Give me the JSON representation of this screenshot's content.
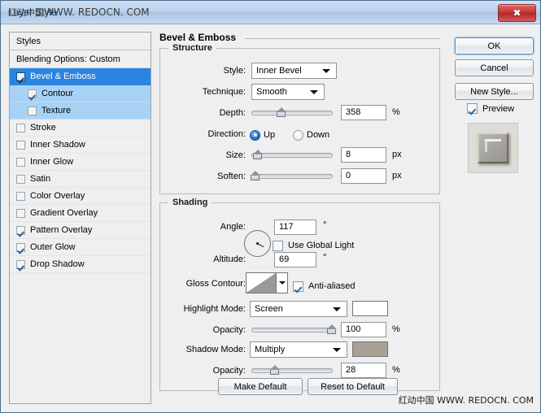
{
  "window": {
    "title": "Layer Style",
    "title_watermark_cn": "红动中国",
    "title_watermark_url": "WWW. REDOCN. COM",
    "close_icon": "close-icon",
    "footer_watermark": "红动中国  WWW. REDOCN. COM"
  },
  "styles_panel": {
    "header": "Styles",
    "blending_options": "Blending Options: Custom",
    "items": [
      {
        "label": "Bevel & Emboss",
        "checked": true,
        "selected": true,
        "sub": false
      },
      {
        "label": "Contour",
        "checked": true,
        "selected": false,
        "sub": true
      },
      {
        "label": "Texture",
        "checked": false,
        "selected": false,
        "sub": true
      },
      {
        "label": "Stroke",
        "checked": false,
        "selected": false,
        "sub": false
      },
      {
        "label": "Inner Shadow",
        "checked": false,
        "selected": false,
        "sub": false
      },
      {
        "label": "Inner Glow",
        "checked": false,
        "selected": false,
        "sub": false
      },
      {
        "label": "Satin",
        "checked": false,
        "selected": false,
        "sub": false
      },
      {
        "label": "Color Overlay",
        "checked": false,
        "selected": false,
        "sub": false
      },
      {
        "label": "Gradient Overlay",
        "checked": false,
        "selected": false,
        "sub": false
      },
      {
        "label": "Pattern Overlay",
        "checked": true,
        "selected": false,
        "sub": false
      },
      {
        "label": "Outer Glow",
        "checked": true,
        "selected": false,
        "sub": false
      },
      {
        "label": "Drop Shadow",
        "checked": true,
        "selected": false,
        "sub": false
      }
    ]
  },
  "effect": {
    "title": "Bevel & Emboss",
    "structure": {
      "title": "Structure",
      "style_label": "Style:",
      "style_value": "Inner Bevel",
      "technique_label": "Technique:",
      "technique_value": "Smooth",
      "depth_label": "Depth:",
      "depth_value": "358",
      "depth_unit": "%",
      "depth_percent": 35,
      "direction_label": "Direction:",
      "direction_up": "Up",
      "direction_down": "Down",
      "direction_selected": "Up",
      "size_label": "Size:",
      "size_value": "8",
      "size_unit": "px",
      "size_percent": 3,
      "soften_label": "Soften:",
      "soften_value": "0",
      "soften_unit": "px",
      "soften_percent": 0
    },
    "shading": {
      "title": "Shading",
      "angle_label": "Angle:",
      "angle_value": "117",
      "angle_unit": "°",
      "use_global_light_label": "Use Global Light",
      "use_global_light_checked": false,
      "altitude_label": "Altitude:",
      "altitude_value": "69",
      "altitude_unit": "°",
      "gloss_contour_label": "Gloss Contour:",
      "anti_aliased_label": "Anti-aliased",
      "anti_aliased_checked": true,
      "highlight_mode_label": "Highlight Mode:",
      "highlight_mode_value": "Screen",
      "highlight_color": "#ffffff",
      "highlight_opacity_label": "Opacity:",
      "highlight_opacity_value": "100",
      "highlight_opacity_unit": "%",
      "highlight_opacity_percent": 100,
      "shadow_mode_label": "Shadow Mode:",
      "shadow_mode_value": "Multiply",
      "shadow_color": "#aaa093",
      "shadow_opacity_label": "Opacity:",
      "shadow_opacity_value": "28",
      "shadow_opacity_unit": "%",
      "shadow_opacity_percent": 28
    }
  },
  "buttons": {
    "ok": "OK",
    "cancel": "Cancel",
    "new_style": "New Style...",
    "preview_label": "Preview",
    "preview_checked": true,
    "make_default": "Make Default",
    "reset_to_default": "Reset to Default"
  },
  "colors": {
    "selection_blue": "#2b84e0",
    "sub_selection_blue": "#a8d2f5",
    "dialog_bg": "#efefef",
    "close_red": "#c63a3a"
  }
}
